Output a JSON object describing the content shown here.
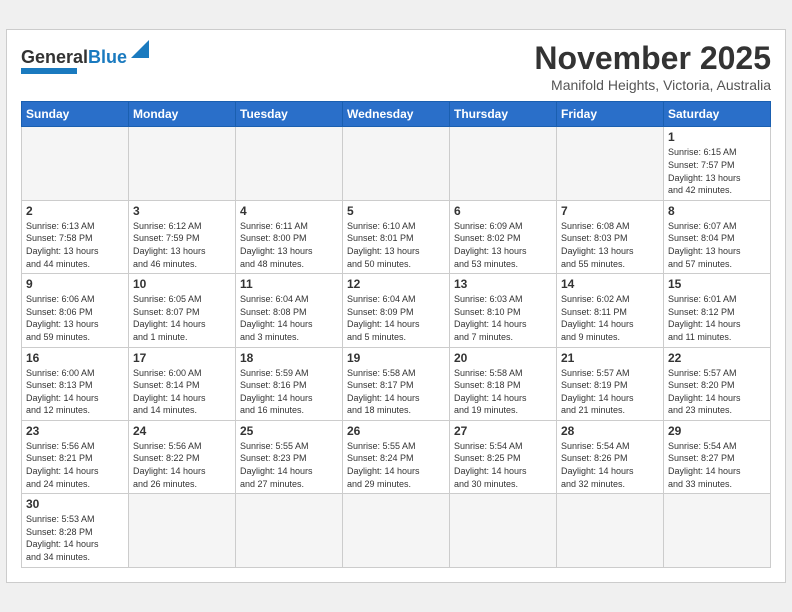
{
  "header": {
    "logo_general": "General",
    "logo_blue": "Blue",
    "month": "November 2025",
    "location": "Manifold Heights, Victoria, Australia"
  },
  "weekdays": [
    "Sunday",
    "Monday",
    "Tuesday",
    "Wednesday",
    "Thursday",
    "Friday",
    "Saturday"
  ],
  "weeks": [
    [
      {
        "day": "",
        "info": ""
      },
      {
        "day": "",
        "info": ""
      },
      {
        "day": "",
        "info": ""
      },
      {
        "day": "",
        "info": ""
      },
      {
        "day": "",
        "info": ""
      },
      {
        "day": "",
        "info": ""
      },
      {
        "day": "1",
        "info": "Sunrise: 6:15 AM\nSunset: 7:57 PM\nDaylight: 13 hours\nand 42 minutes."
      }
    ],
    [
      {
        "day": "2",
        "info": "Sunrise: 6:13 AM\nSunset: 7:58 PM\nDaylight: 13 hours\nand 44 minutes."
      },
      {
        "day": "3",
        "info": "Sunrise: 6:12 AM\nSunset: 7:59 PM\nDaylight: 13 hours\nand 46 minutes."
      },
      {
        "day": "4",
        "info": "Sunrise: 6:11 AM\nSunset: 8:00 PM\nDaylight: 13 hours\nand 48 minutes."
      },
      {
        "day": "5",
        "info": "Sunrise: 6:10 AM\nSunset: 8:01 PM\nDaylight: 13 hours\nand 50 minutes."
      },
      {
        "day": "6",
        "info": "Sunrise: 6:09 AM\nSunset: 8:02 PM\nDaylight: 13 hours\nand 53 minutes."
      },
      {
        "day": "7",
        "info": "Sunrise: 6:08 AM\nSunset: 8:03 PM\nDaylight: 13 hours\nand 55 minutes."
      },
      {
        "day": "8",
        "info": "Sunrise: 6:07 AM\nSunset: 8:04 PM\nDaylight: 13 hours\nand 57 minutes."
      }
    ],
    [
      {
        "day": "9",
        "info": "Sunrise: 6:06 AM\nSunset: 8:06 PM\nDaylight: 13 hours\nand 59 minutes."
      },
      {
        "day": "10",
        "info": "Sunrise: 6:05 AM\nSunset: 8:07 PM\nDaylight: 14 hours\nand 1 minute."
      },
      {
        "day": "11",
        "info": "Sunrise: 6:04 AM\nSunset: 8:08 PM\nDaylight: 14 hours\nand 3 minutes."
      },
      {
        "day": "12",
        "info": "Sunrise: 6:04 AM\nSunset: 8:09 PM\nDaylight: 14 hours\nand 5 minutes."
      },
      {
        "day": "13",
        "info": "Sunrise: 6:03 AM\nSunset: 8:10 PM\nDaylight: 14 hours\nand 7 minutes."
      },
      {
        "day": "14",
        "info": "Sunrise: 6:02 AM\nSunset: 8:11 PM\nDaylight: 14 hours\nand 9 minutes."
      },
      {
        "day": "15",
        "info": "Sunrise: 6:01 AM\nSunset: 8:12 PM\nDaylight: 14 hours\nand 11 minutes."
      }
    ],
    [
      {
        "day": "16",
        "info": "Sunrise: 6:00 AM\nSunset: 8:13 PM\nDaylight: 14 hours\nand 12 minutes."
      },
      {
        "day": "17",
        "info": "Sunrise: 6:00 AM\nSunset: 8:14 PM\nDaylight: 14 hours\nand 14 minutes."
      },
      {
        "day": "18",
        "info": "Sunrise: 5:59 AM\nSunset: 8:16 PM\nDaylight: 14 hours\nand 16 minutes."
      },
      {
        "day": "19",
        "info": "Sunrise: 5:58 AM\nSunset: 8:17 PM\nDaylight: 14 hours\nand 18 minutes."
      },
      {
        "day": "20",
        "info": "Sunrise: 5:58 AM\nSunset: 8:18 PM\nDaylight: 14 hours\nand 19 minutes."
      },
      {
        "day": "21",
        "info": "Sunrise: 5:57 AM\nSunset: 8:19 PM\nDaylight: 14 hours\nand 21 minutes."
      },
      {
        "day": "22",
        "info": "Sunrise: 5:57 AM\nSunset: 8:20 PM\nDaylight: 14 hours\nand 23 minutes."
      }
    ],
    [
      {
        "day": "23",
        "info": "Sunrise: 5:56 AM\nSunset: 8:21 PM\nDaylight: 14 hours\nand 24 minutes."
      },
      {
        "day": "24",
        "info": "Sunrise: 5:56 AM\nSunset: 8:22 PM\nDaylight: 14 hours\nand 26 minutes."
      },
      {
        "day": "25",
        "info": "Sunrise: 5:55 AM\nSunset: 8:23 PM\nDaylight: 14 hours\nand 27 minutes."
      },
      {
        "day": "26",
        "info": "Sunrise: 5:55 AM\nSunset: 8:24 PM\nDaylight: 14 hours\nand 29 minutes."
      },
      {
        "day": "27",
        "info": "Sunrise: 5:54 AM\nSunset: 8:25 PM\nDaylight: 14 hours\nand 30 minutes."
      },
      {
        "day": "28",
        "info": "Sunrise: 5:54 AM\nSunset: 8:26 PM\nDaylight: 14 hours\nand 32 minutes."
      },
      {
        "day": "29",
        "info": "Sunrise: 5:54 AM\nSunset: 8:27 PM\nDaylight: 14 hours\nand 33 minutes."
      }
    ],
    [
      {
        "day": "30",
        "info": "Sunrise: 5:53 AM\nSunset: 8:28 PM\nDaylight: 14 hours\nand 34 minutes."
      },
      {
        "day": "",
        "info": ""
      },
      {
        "day": "",
        "info": ""
      },
      {
        "day": "",
        "info": ""
      },
      {
        "day": "",
        "info": ""
      },
      {
        "day": "",
        "info": ""
      },
      {
        "day": "",
        "info": ""
      }
    ]
  ]
}
